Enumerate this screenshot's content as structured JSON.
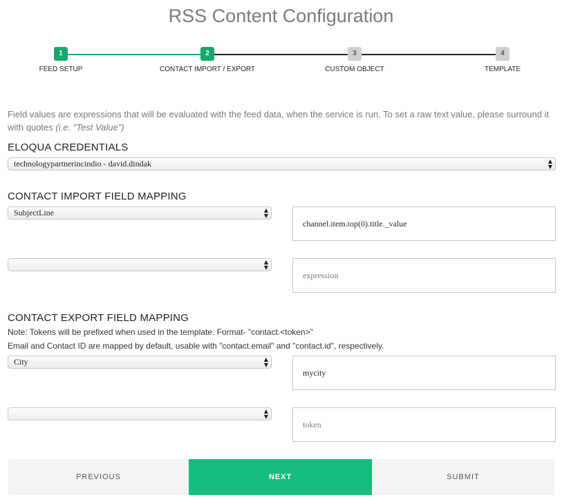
{
  "header": {
    "title": "RSS Content Configuration"
  },
  "stepper": {
    "steps": [
      {
        "number": "1",
        "label": "FEED SETUP",
        "state": "complete"
      },
      {
        "number": "2",
        "label": "CONTACT IMPORT / EXPORT",
        "state": "current"
      },
      {
        "number": "3",
        "label": "CUSTOM OBJECT",
        "state": "pending"
      },
      {
        "number": "4",
        "label": "TEMPLATE",
        "state": "pending"
      }
    ],
    "active_color": "#16a86e"
  },
  "intro": {
    "text": "Field values are expressions that will be evaluated with the feed data, when the service is run. To set a raw text value, please surround it with quotes ",
    "example": "(i.e. \"Test Value\")"
  },
  "credentials": {
    "heading": "ELOQUA CREDENTIALS",
    "selected": "technologypartnerincindio - david.dindak"
  },
  "import_mapping": {
    "heading": "CONTACT IMPORT FIELD MAPPING",
    "rows": [
      {
        "field": "SubjectLine",
        "value": "channel.item.top(0).title._value",
        "placeholder": "expression"
      },
      {
        "field": "",
        "value": "",
        "placeholder": "expression"
      }
    ]
  },
  "export_mapping": {
    "heading": "CONTACT EXPORT FIELD MAPPING",
    "note1": "Note: Tokens will be prefixed when used in the template. Format- \"contact.<token>\"",
    "note2": "Email and Contact ID are mapped by default, usable with \"contact.email\" and \"contact.id\", respectively.",
    "rows": [
      {
        "field": "City",
        "value": "mycity",
        "placeholder": "token"
      },
      {
        "field": "",
        "value": "",
        "placeholder": "token"
      }
    ]
  },
  "footer": {
    "previous_label": "PREVIOUS",
    "next_label": "NEXT",
    "submit_label": "SUBMIT",
    "next_color": "#16bd7e"
  }
}
